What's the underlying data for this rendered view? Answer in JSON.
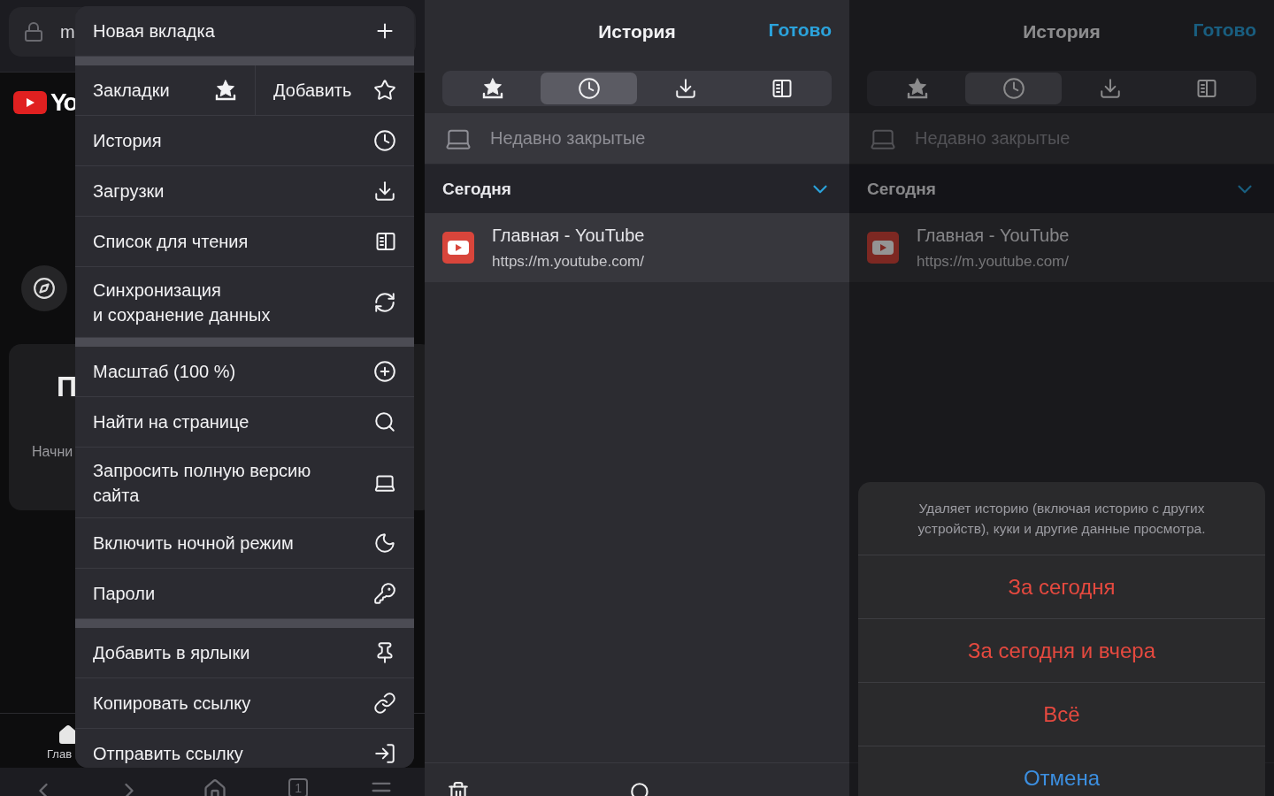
{
  "browser_screen": {
    "address_text": "m",
    "logo_text": "Yo",
    "card_title": "П",
    "card_text": "Начни",
    "nav_label": "Глав",
    "tab_count": "1",
    "menu": {
      "groups": [
        {
          "items": [
            {
              "kind": "single",
              "label": "Новая вкладка"
            }
          ]
        },
        {
          "items": [
            {
              "kind": "split",
              "label": "Закладки",
              "secondary_label": "Добавить"
            },
            {
              "kind": "single",
              "label": "История"
            },
            {
              "kind": "single",
              "label": "Загрузки"
            },
            {
              "kind": "single",
              "label": "Список для чтения"
            },
            {
              "kind": "single",
              "label": "Синхронизация\nи сохранение данных"
            }
          ]
        },
        {
          "items": [
            {
              "kind": "single",
              "label": "Масштаб (100 %)"
            },
            {
              "kind": "single",
              "label": "Найти на странице"
            },
            {
              "kind": "single",
              "label": "Запросить полную версию\nсайта"
            },
            {
              "kind": "single",
              "label": "Включить ночной режим"
            },
            {
              "kind": "single",
              "label": "Пароли"
            }
          ]
        },
        {
          "items": [
            {
              "kind": "single",
              "label": "Добавить в ярлыки"
            },
            {
              "kind": "single",
              "label": "Копировать ссылку"
            },
            {
              "kind": "single",
              "label": "Отправить ссылку"
            }
          ]
        }
      ]
    }
  },
  "history_screen": {
    "title": "История",
    "done": "Готово",
    "tabs": [
      {
        "selected": false
      },
      {
        "selected": true
      },
      {
        "selected": false
      },
      {
        "selected": false
      }
    ],
    "recently_closed": "Недавно закрытые",
    "section": {
      "title": "Сегодня",
      "expanded": true
    },
    "entries": [
      {
        "title": "Главная - YouTube",
        "url": "https://m.youtube.com/"
      }
    ]
  },
  "history_screen_dimmed": {
    "title": "История",
    "done": "Готово",
    "tabs": [
      {
        "selected": false
      },
      {
        "selected": true
      },
      {
        "selected": false
      },
      {
        "selected": false
      }
    ],
    "recently_closed": "Недавно закрытые",
    "section": {
      "title": "Сегодня",
      "expanded": true
    },
    "entries": [
      {
        "title": "Главная - YouTube",
        "url": "https://m.youtube.com/"
      }
    ],
    "action_sheet": {
      "message": "Удаляет историю (включая историю с других устройств), куки и другие данные просмотра.",
      "buttons": [
        {
          "label": "За сегодня",
          "kind": "destructive"
        },
        {
          "label": "За сегодня и вчера",
          "kind": "destructive"
        },
        {
          "label": "Всё",
          "kind": "destructive"
        },
        {
          "label": "Отмена",
          "kind": "cancel"
        }
      ]
    }
  }
}
